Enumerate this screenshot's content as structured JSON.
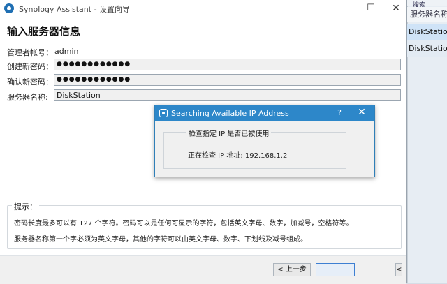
{
  "window": {
    "title": "Synology Assistant - 设置向导",
    "minimize": "—",
    "maximize": "☐",
    "close": "✕"
  },
  "heading": "输入服务器信息",
  "fields": {
    "admin_label": "管理者帐号：",
    "admin_value": "admin",
    "new_password_label": "创建新密码：",
    "new_password_value": "●●●●●●●●●●●●",
    "confirm_password_label": "确认新密码：",
    "confirm_password_value": "●●●●●●●●●●●●",
    "server_name_label": "服务器名称:",
    "server_name_value": "DiskStation"
  },
  "hint": {
    "title": "提示：",
    "line1": "密码长度最多可以有 127 个字符。密码可以是任何可显示的字符，包括英文字母、数字，加减号，空格符等。",
    "line2": "服务器名称第一个字必须为英文字母，其他的字符可以由英文字母、数字、下划线及减号组成。"
  },
  "buttons": {
    "prev": "< 上一步",
    "next": "",
    "edge": "<"
  },
  "popup": {
    "title": "Searching Available IP Address",
    "help": "?",
    "close": "✕",
    "group_label": "检查指定 IP 是否已被使用",
    "status": "正在检查 IP 地址:  192.168.1.2"
  },
  "background_app": {
    "tab": "搜索",
    "column_header": "服务器名称",
    "rows": [
      "DiskStation",
      "DiskStation"
    ]
  },
  "colors": {
    "accent": "#2d87c9",
    "selected_row": "#cfe3f7"
  }
}
